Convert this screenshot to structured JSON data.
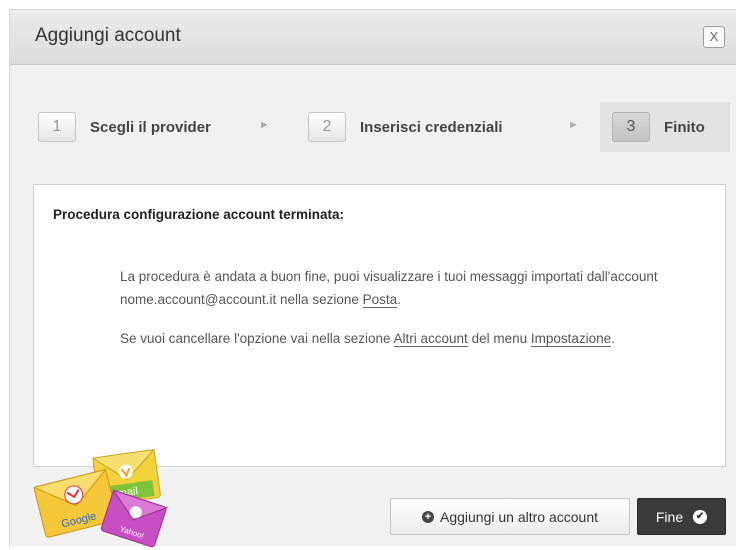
{
  "dialog": {
    "title": "Aggiungi account",
    "close_label": "X"
  },
  "steps": [
    {
      "number": "1",
      "label": "Scegli il provider",
      "active": false
    },
    {
      "number": "2",
      "label": "Inserisci credenziali",
      "active": false
    },
    {
      "number": "3",
      "label": "Finito",
      "active": true
    }
  ],
  "step_separator": "►",
  "content": {
    "heading": "Procedura configurazione account terminata:",
    "para1_before": "La procedura è andata a buon fine, puoi visualizzare i tuoi messaggi importati dall'account nome.account@account.it nella sezione ",
    "para1_link": "Posta",
    "para1_after": ".",
    "para2_before": "Se vuoi cancellare l'opzione vai nella sezione ",
    "para2_link1": "Altri account",
    "para2_middle": " del menu ",
    "para2_link2": "Impostazione",
    "para2_after": "."
  },
  "logos": {
    "gmail": "Google",
    "hotmail": "mail",
    "yahoo": "Yahoo!"
  },
  "buttons": {
    "add_account": "Aggiungi un altro account",
    "add_icon": "+",
    "done": "Fine",
    "done_icon": "✔"
  }
}
